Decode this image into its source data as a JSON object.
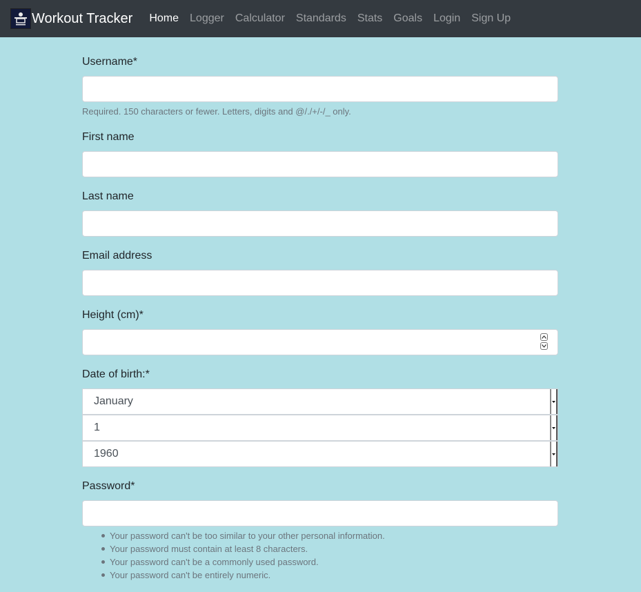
{
  "navbar": {
    "brand": "Workout Tracker",
    "links": [
      "Home",
      "Logger",
      "Calculator",
      "Standards",
      "Stats",
      "Goals",
      "Login",
      "Sign Up"
    ]
  },
  "form": {
    "username_label": "Username*",
    "username_help": "Required. 150 characters or fewer. Letters, digits and @/./+/-/_ only.",
    "first_name_label": "First name",
    "last_name_label": "Last name",
    "email_label": "Email address",
    "height_label": "Height (cm)*",
    "dob_label": "Date of birth:*",
    "dob_month": "January",
    "dob_day": "1",
    "dob_year": "1960",
    "password_label": "Password*",
    "password_rules": [
      "Your password can't be too similar to your other personal information.",
      "Your password must contain at least 8 characters.",
      "Your password can't be a commonly used password.",
      "Your password can't be entirely numeric."
    ]
  }
}
